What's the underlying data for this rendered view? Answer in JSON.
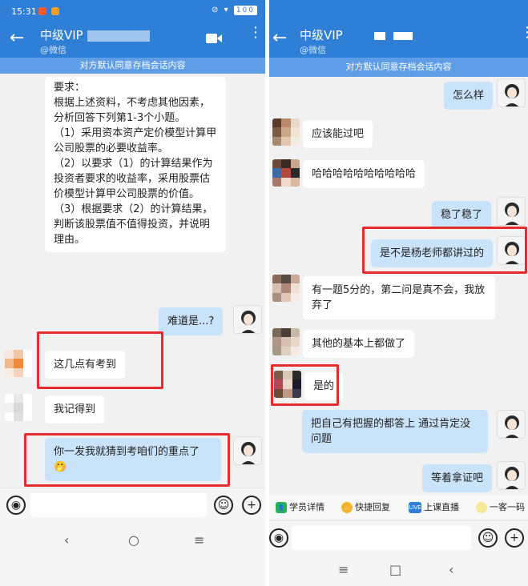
{
  "left": {
    "status": {
      "time": "15:31",
      "battery": "100"
    },
    "header": {
      "title": "中级VIP",
      "subtitle": "@微信"
    },
    "notice": "对方默认同意存档会话内容",
    "messages": [
      {
        "side": "in",
        "text": "要求：\n根据上述资料，不考虑其他因素，分析回答下列第1-3个小题。\n（1）采用资本资产定价模型计算甲公司股票的必要收益率。\n（2）以要求（1）的计算结果作为投资者要求的收益率，采用股票估价模型计算甲公司股票的价值。\n（3）根据要求（2）的计算结果，判断该股票值不值得投资，并说明理由。"
      },
      {
        "side": "out",
        "text": "难道是...?"
      },
      {
        "side": "in",
        "text": "这几点有考到"
      },
      {
        "side": "in",
        "text": "我记得到"
      },
      {
        "side": "out",
        "text": "你一发我就猜到考咱们的重点了🤭"
      }
    ]
  },
  "right": {
    "header": {
      "title": "中级VIP",
      "subtitle": "@微信"
    },
    "notice": "对方默认同意存档会话内容",
    "messages": [
      {
        "side": "out",
        "text": "怎么样"
      },
      {
        "side": "in",
        "text": "应该能过吧"
      },
      {
        "side": "in",
        "text": "哈哈哈哈哈哈哈哈哈哈"
      },
      {
        "side": "out",
        "text": "稳了稳了"
      },
      {
        "side": "out",
        "text": "是不是杨老师都讲过的"
      },
      {
        "side": "in",
        "text": "有一题5分的，第二问是真不会，我放弃了"
      },
      {
        "side": "in",
        "text": "其他的基本上都做了"
      },
      {
        "side": "in",
        "text": "是的"
      },
      {
        "side": "out",
        "text": "把自己有把握的都答上 通过肯定没问题"
      },
      {
        "side": "out",
        "text": "等着拿证吧"
      }
    ],
    "quick_actions": [
      "学员详情",
      "快捷回复",
      "上课直播",
      "一客一码"
    ],
    "quick_icons": {
      "live": "LIVE"
    }
  },
  "nav": {
    "back": "‹",
    "home": "○",
    "menu": "≡"
  },
  "colors": {
    "header": "#2f7fd6",
    "notice": "#5f9ee6",
    "bubble_out": "#c9e3fb",
    "highlight": "#e52b2b"
  }
}
